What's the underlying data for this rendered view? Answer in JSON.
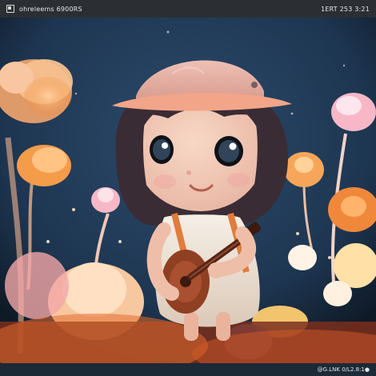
{
  "header": {
    "left_text": "ohreleems 6900RS",
    "right_text": "1ERT 253 3:21"
  },
  "footer": {
    "caption": "@G.LNK 0/L2.8:1●"
  },
  "scene": {
    "background_color": "#213a55",
    "accent_color": "#f1a65b",
    "character": {
      "hat_color": "#e4b2a8",
      "hair_color": "#3a2c34",
      "dress_color": "#f1e8dc",
      "guitar_color": "#8f3f22"
    }
  },
  "icons": [
    "logo-icon"
  ]
}
